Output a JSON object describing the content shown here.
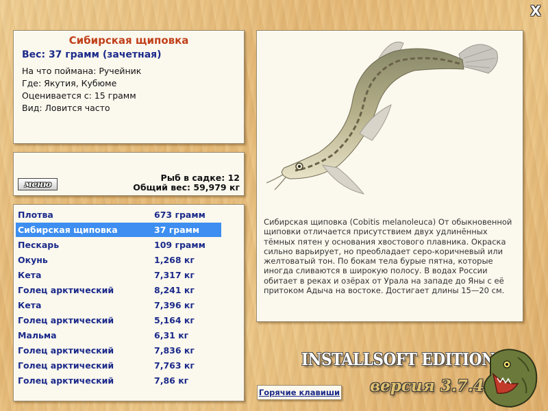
{
  "window": {
    "close_label": "X"
  },
  "fish": {
    "title": "Сибирская щиповка",
    "weight_line": "Вес: 37 грамм (зачетная)",
    "caught_with": "На что поймана: Ручейник",
    "location": "Где: Якутия, Кубюме",
    "rated_from": "Оценивается с: 15 грамм",
    "frequency": "Вид: Ловится часто",
    "description": "Сибирская щиповка (Cobitis melanoleuca) От обыкновенной щиповки отличается присутствием двух удлинённых тёмных пятен у основания хвостового плавника. Окраска сильно варьирует, но преобладает серо-коричневый или желтоватый тон. По бокам тела бурые пятна, которые иногда сливаются в широкую полосу. В водах России обитает в реках и озёрах от Урала на западе до Яны с её притоком Адыча на востоке. Достигает длины 15—20 см."
  },
  "stats": {
    "menu_label": "меню",
    "fish_in_keepnet": "Рыб в садке: 12",
    "total_weight": "Общий вес: 59,979 кг"
  },
  "catch_list": [
    {
      "name": "Плотва",
      "weight": "673 грамм",
      "selected": false
    },
    {
      "name": "Сибирская щиповка",
      "weight": "37 грамм",
      "selected": true
    },
    {
      "name": "Пескарь",
      "weight": "109 грамм",
      "selected": false
    },
    {
      "name": "Окунь",
      "weight": "1,268 кг",
      "selected": false
    },
    {
      "name": "Кета",
      "weight": "7,317 кг",
      "selected": false
    },
    {
      "name": "Голец арктический",
      "weight": "8,241 кг",
      "selected": false
    },
    {
      "name": "Кета",
      "weight": "7,396 кг",
      "selected": false
    },
    {
      "name": "Голец арктический",
      "weight": "5,164 кг",
      "selected": false
    },
    {
      "name": "Мальма",
      "weight": "6,31 кг",
      "selected": false
    },
    {
      "name": "Голец арктический",
      "weight": "7,836 кг",
      "selected": false
    },
    {
      "name": "Голец арктический",
      "weight": "7,763 кг",
      "selected": false
    },
    {
      "name": "Голец арктический",
      "weight": "7,86 кг",
      "selected": false
    }
  ],
  "footer": {
    "hotkeys_label": "Горячие клавиши",
    "brand": "INSTALLSOFT EDITION",
    "version": "версия 3.7.4"
  },
  "icons": {
    "close": "close-icon",
    "fish_picture": "loach-fish-illustration",
    "logo": "pike-logo-icon"
  },
  "colors": {
    "title_red": "#c0401a",
    "link_blue": "#1b2a8a",
    "selection_blue": "#3d8ef0",
    "panel_bg": "#fbf8ee"
  }
}
